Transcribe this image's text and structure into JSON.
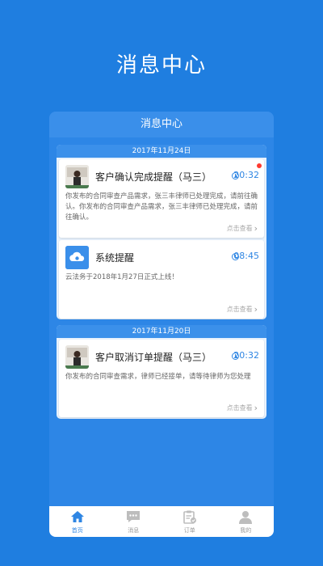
{
  "hero": {
    "title": "消息中心"
  },
  "app": {
    "header_title": "消息中心"
  },
  "groups": [
    {
      "date": "2017年11月24日",
      "messages": [
        {
          "title": "客户确认完成提醒（马三）",
          "time": "20:32",
          "unread": true,
          "body": "你发布的合同审查产品需求，张三丰律师已处理完成，请前往确认。你发布的合同审查产品需求，张三丰律师已处理完成，请前往确认。",
          "more": "点击查看",
          "avatar_icon": "user-photo-icon"
        },
        {
          "title": "系统提醒",
          "time": "08:45",
          "unread": false,
          "body": "云法务于2018年1月27日正式上线！",
          "more": "点击查看",
          "avatar_icon": "cloud-logo-icon"
        }
      ]
    },
    {
      "date": "2017年11月20日",
      "messages": [
        {
          "title": "客户取消订单提醒（马三）",
          "time": "20:32",
          "unread": false,
          "body": "你发布的合同审查需求，律师已经接单，请等待律师为您处理",
          "more": "点击查看",
          "avatar_icon": "user-photo-icon"
        }
      ]
    }
  ],
  "tabbar": [
    {
      "label": "首页",
      "icon": "home-icon",
      "active": true
    },
    {
      "label": "消息",
      "icon": "message-icon",
      "active": false
    },
    {
      "label": "订单",
      "icon": "order-icon",
      "active": false
    },
    {
      "label": "我的",
      "icon": "profile-icon",
      "active": false
    }
  ],
  "colors": {
    "background": "#1f7ee0",
    "accent": "#2f86e3",
    "unread_dot": "#ff3a30"
  }
}
